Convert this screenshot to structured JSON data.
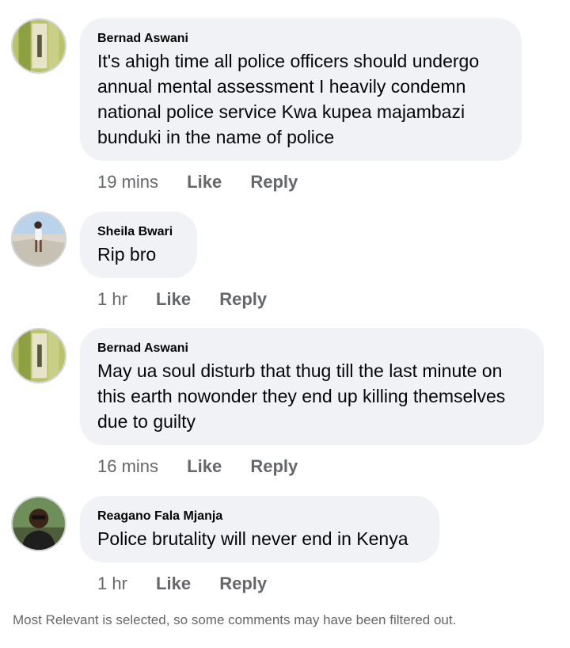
{
  "comments": [
    {
      "author": "Bernad Aswani",
      "text": "It's ahigh time all police officers should undergo annual mental assessment I heavily condemn national police service Kwa kupea majambazi bunduki in the name of police",
      "time": "19 mins",
      "like_label": "Like",
      "reply_label": "Reply",
      "avatar_icon": "avatar-photo-icon"
    },
    {
      "author": "Sheila Bwari",
      "text": "Rip bro",
      "time": "1 hr",
      "like_label": "Like",
      "reply_label": "Reply",
      "avatar_icon": "avatar-photo-icon"
    },
    {
      "author": "Bernad Aswani",
      "text": "May ua soul disturb that thug till the last minute on this earth nowonder they end up killing themselves due to guilty",
      "time": "16 mins",
      "like_label": "Like",
      "reply_label": "Reply",
      "avatar_icon": "avatar-photo-icon"
    },
    {
      "author": "Reagano Fala Mjanja",
      "text": "Police brutality will never end in Kenya",
      "time": "1 hr",
      "like_label": "Like",
      "reply_label": "Reply",
      "avatar_icon": "avatar-photo-icon"
    }
  ],
  "footer_note": "Most Relevant is selected, so some comments may have been filtered out.",
  "colors": {
    "bubble_bg": "#f0f2f5",
    "secondary_text": "#65676b",
    "primary_text": "#050505"
  }
}
